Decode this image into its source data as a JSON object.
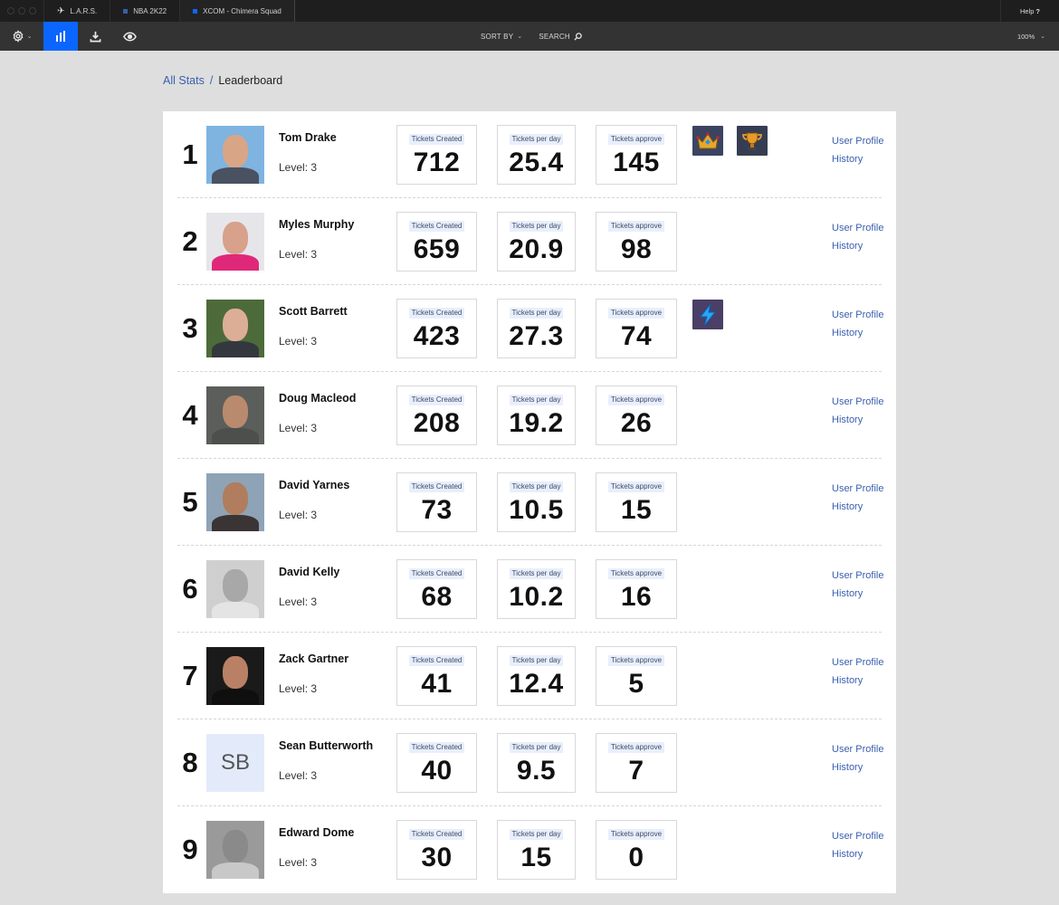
{
  "window": {
    "tabs": [
      {
        "label": "L.A.R.S.",
        "icon": "lars-logo-icon",
        "active": false
      },
      {
        "label": "NBA 2K22",
        "icon": "square-icon",
        "color": "#3b5ca8",
        "active": false
      },
      {
        "label": "XCOM - Chimera Squad",
        "icon": "square-icon",
        "color": "#0b66ff",
        "active": true
      }
    ],
    "help_label": "Help",
    "help_icon": "?"
  },
  "toolbar": {
    "settings_icon": "gear-icon",
    "stats_icon": "bar-chart-icon",
    "download_icon": "download-icon",
    "view_icon": "eye-icon",
    "sort_label": "SORT BY",
    "search_label": "SEARCH",
    "zoom_value": "100%",
    "accent": "#0b66ff"
  },
  "breadcrumb": {
    "parent": "All Stats",
    "separator": "/",
    "current": "Leaderboard"
  },
  "stat_labels": {
    "created": "Tickets Created",
    "per_day": "Tickets per day",
    "approved": "Tickets approve"
  },
  "links": {
    "profile": "User Profile",
    "history": "History"
  },
  "leaderboard": [
    {
      "rank": "1",
      "name": "Tom Drake",
      "level": "Level: 3",
      "created": "712",
      "per_day": "25.4",
      "approved": "145",
      "badges": [
        "crown-badge-icon",
        "trophy-badge-icon"
      ],
      "photo": {
        "bg": "#7fb4e0",
        "skin": "#d9a587",
        "shirt": "#4a5160"
      }
    },
    {
      "rank": "2",
      "name": "Myles Murphy",
      "level": "Level: 3",
      "created": "659",
      "per_day": "20.9",
      "approved": "98",
      "badges": [],
      "photo": {
        "bg": "#e6e6ea",
        "skin": "#d7a18c",
        "shirt": "#e0287a"
      }
    },
    {
      "rank": "3",
      "name": "Scott Barrett",
      "level": "Level: 3",
      "created": "423",
      "per_day": "27.3",
      "approved": "74",
      "badges": [
        "lightning-badge-icon"
      ],
      "photo": {
        "bg": "#4d6b3a",
        "skin": "#dcae95",
        "shirt": "#33383f"
      }
    },
    {
      "rank": "4",
      "name": "Doug Macleod",
      "level": "Level: 3",
      "created": "208",
      "per_day": "19.2",
      "approved": "26",
      "badges": [],
      "photo": {
        "bg": "#5b5e5a",
        "skin": "#b98a6d",
        "shirt": "#4c4f4c"
      }
    },
    {
      "rank": "5",
      "name": "David Yarnes",
      "level": "Level: 3",
      "created": "73",
      "per_day": "10.5",
      "approved": "15",
      "badges": [],
      "photo": {
        "bg": "#8fa3b6",
        "skin": "#b07d5f",
        "shirt": "#3a3434"
      }
    },
    {
      "rank": "6",
      "name": "David Kelly",
      "level": "Level: 3",
      "created": "68",
      "per_day": "10.2",
      "approved": "16",
      "badges": [],
      "photo": {
        "bg": "#cfcfcf",
        "skin": "#a8a8a8",
        "shirt": "#e4e4e4"
      }
    },
    {
      "rank": "7",
      "name": "Zack Gartner",
      "level": "Level: 3",
      "created": "41",
      "per_day": "12.4",
      "approved": "5",
      "badges": [],
      "photo": {
        "bg": "#1a1a1a",
        "skin": "#b98066",
        "shirt": "#0f0f0f"
      }
    },
    {
      "rank": "8",
      "name": "Sean Butterworth",
      "level": "Level: 3",
      "created": "40",
      "per_day": "9.5",
      "approved": "7",
      "badges": [],
      "initials": "SB"
    },
    {
      "rank": "9",
      "name": "Edward Dome",
      "level": "Level: 3",
      "created": "30",
      "per_day": "15",
      "approved": "0",
      "badges": [],
      "photo": {
        "bg": "#9a9a9a",
        "skin": "#8a8a8a",
        "shirt": "#c8c8c8"
      }
    }
  ]
}
